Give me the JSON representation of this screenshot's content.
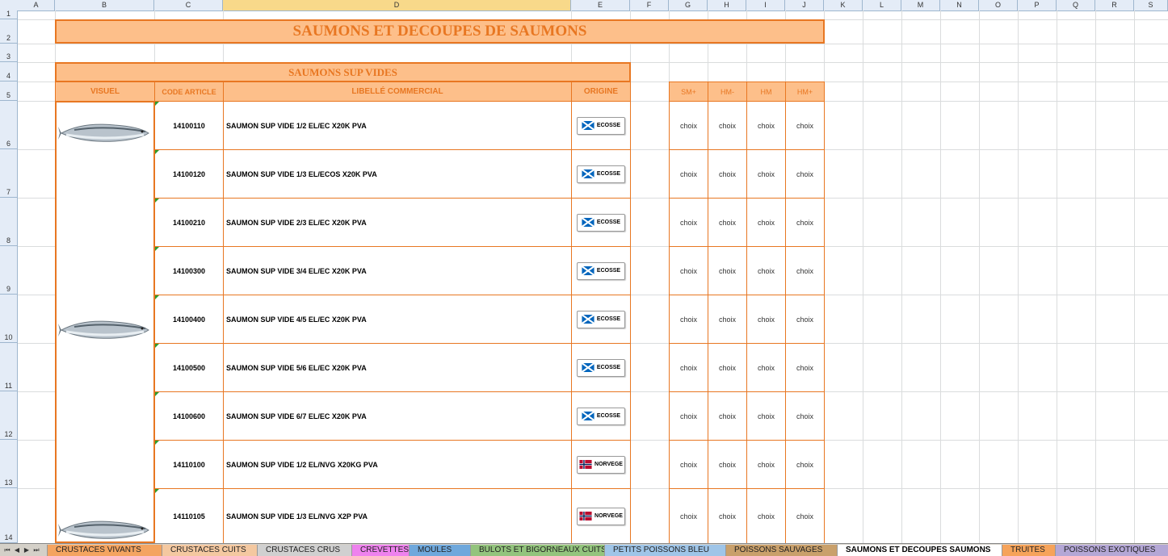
{
  "columns": [
    "A",
    "B",
    "C",
    "D",
    "E",
    "F",
    "G",
    "H",
    "I",
    "J",
    "K",
    "L",
    "M",
    "N",
    "O",
    "P",
    "Q",
    "R",
    "S"
  ],
  "rows": [
    "1",
    "2",
    "3",
    "4",
    "5",
    "6",
    "7",
    "8",
    "9",
    "10",
    "11",
    "12",
    "13",
    "14"
  ],
  "main_title": "SAUMONS ET DECOUPES DE SAUMONS",
  "section_title": "SAUMONS SUP VIDES",
  "headers": {
    "visuel": "VISUEL",
    "code": "CODE ARTICLE",
    "libelle": "LIBELLÉ COMMERCIAL",
    "origine": "ORIGINE"
  },
  "grade_headers": [
    "SM+",
    "HM-",
    "HM",
    "HM+"
  ],
  "products": [
    {
      "code": "14100110",
      "label": "SAUMON SUP VIDE 1/2 EL/EC X20K PVA",
      "origin": "ECOSSE",
      "flag": "scotland"
    },
    {
      "code": "14100120",
      "label": "SAUMON SUP VIDE 1/3 EL/ECOS X20K PVA",
      "origin": "ECOSSE",
      "flag": "scotland"
    },
    {
      "code": "14100210",
      "label": "SAUMON SUP VIDE 2/3 EL/EC X20K PVA",
      "origin": "ECOSSE",
      "flag": "scotland"
    },
    {
      "code": "14100300",
      "label": "SAUMON SUP VIDE 3/4 EL/EC X20K PVA",
      "origin": "ECOSSE",
      "flag": "scotland"
    },
    {
      "code": "14100400",
      "label": "SAUMON SUP VIDE 4/5 EL/EC X20K PVA",
      "origin": "ECOSSE",
      "flag": "scotland"
    },
    {
      "code": "14100500",
      "label": "SAUMON SUP VIDE 5/6 EL/EC X20K PVA",
      "origin": "ECOSSE",
      "flag": "scotland"
    },
    {
      "code": "14100600",
      "label": "SAUMON SUP VIDE 6/7 EL/EC X20K PVA",
      "origin": "ECOSSE",
      "flag": "scotland"
    },
    {
      "code": "14110100",
      "label": "SAUMON SUP VIDE 1/2 EL/NVG X20KG PVA",
      "origin": "NORVEGE",
      "flag": "norway"
    },
    {
      "code": "14110105",
      "label": "SAUMON SUP VIDE 1/3 EL/NVG X2P PVA",
      "origin": "NORVEGE",
      "flag": "norway"
    }
  ],
  "choice_text": "choix",
  "sheet_tabs": [
    {
      "label": "CRUSTACES VIVANTS",
      "color": "#f4a460"
    },
    {
      "label": "CRUSTACES CUITS",
      "color": "#f4c8a0"
    },
    {
      "label": "CRUSTACES CRUS",
      "color": "#d0d0d0"
    },
    {
      "label": "CREVETTES",
      "color": "#ee82ee"
    },
    {
      "label": "MOULES",
      "color": "#6fa8dc"
    },
    {
      "label": "BULOTS ET BIGORNEAUX CUITS",
      "color": "#93c47d"
    },
    {
      "label": "PETITS POISSONS BLEU",
      "color": "#9fc5e8"
    },
    {
      "label": "POISSONS SAUVAGES",
      "color": "#c9a06b"
    },
    {
      "label": "SAUMONS ET DECOUPES SAUMONS",
      "color": "#ffffff",
      "active": true
    },
    {
      "label": "TRUITES",
      "color": "#f6a35a"
    },
    {
      "label": "POISSONS EXOTIQUES",
      "color": "#b4a7d6"
    }
  ]
}
